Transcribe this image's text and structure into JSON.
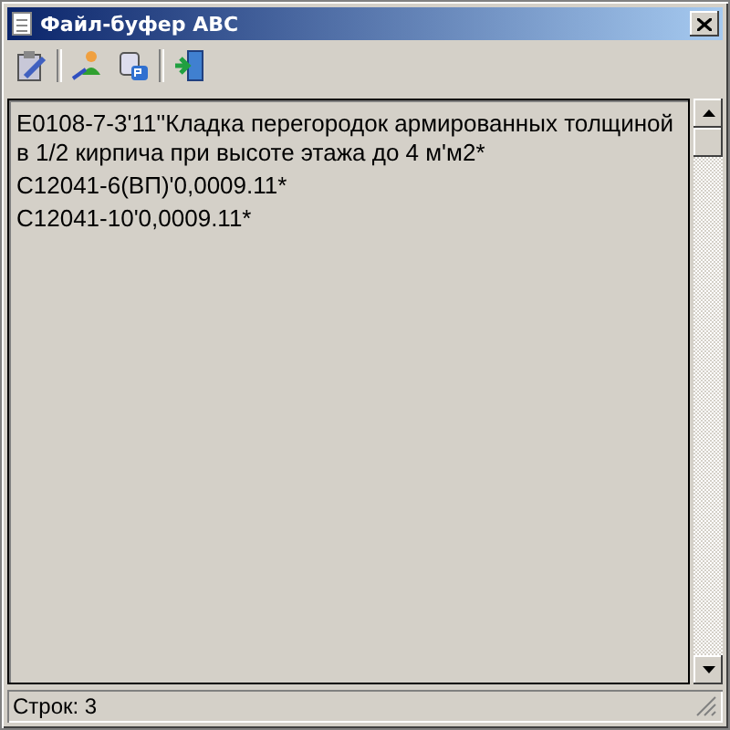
{
  "window": {
    "title": "Файл-буфер ABC"
  },
  "toolbar": {
    "buttons": [
      {
        "kind": "clipboard"
      },
      {
        "kind": "separator"
      },
      {
        "kind": "person"
      },
      {
        "kind": "paste"
      },
      {
        "kind": "separator"
      },
      {
        "kind": "exit"
      }
    ]
  },
  "lines": [
    "E0108-7-3'11''Кладка перегородок армированных толщиной в 1/2 кирпича при высоте этажа до 4 м'м2*",
    "C12041-6(ВП)'0,0009.11*",
    "C12041-10'0,0009.11*"
  ],
  "status_bar": "Строк: 3"
}
